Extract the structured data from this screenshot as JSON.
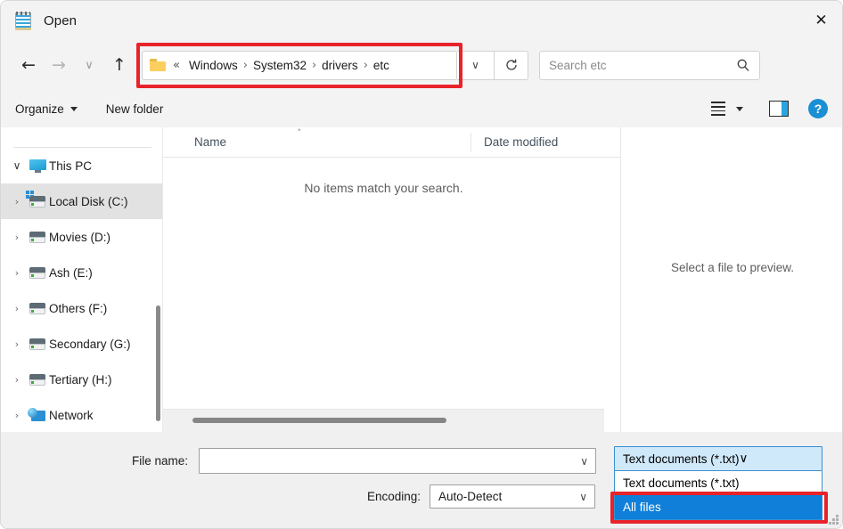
{
  "window": {
    "title": "Open",
    "app_icon": "notepad-icon",
    "close_label": "✕"
  },
  "nav": {
    "back": "←",
    "forward": "→",
    "recent": "∨",
    "up": "↑",
    "dropdown": "∨",
    "refresh_icon": "refresh-icon"
  },
  "breadcrumb": {
    "folder_icon": "folder-icon",
    "overflow": "«",
    "separator": "›",
    "items": [
      "Windows",
      "System32",
      "drivers",
      "etc"
    ]
  },
  "search": {
    "placeholder": "Search etc",
    "icon": "search-icon"
  },
  "commandbar": {
    "organize": "Organize",
    "new_folder": "New folder",
    "view_icon": "list-view-icon",
    "view_caret": "▾",
    "preview_pane_icon": "preview-pane-icon",
    "help": "?"
  },
  "sidebar": {
    "items": [
      {
        "label": "This PC",
        "icon": "computer-icon",
        "chevron": "∨",
        "expanded": true,
        "selected": false
      },
      {
        "label": "Local Disk (C:)",
        "icon": "windows-drive-icon",
        "chevron": "›",
        "expanded": false,
        "selected": true
      },
      {
        "label": "Movies (D:)",
        "icon": "drive-icon",
        "chevron": "›",
        "expanded": false,
        "selected": false
      },
      {
        "label": "Ash (E:)",
        "icon": "drive-icon",
        "chevron": "›",
        "expanded": false,
        "selected": false
      },
      {
        "label": "Others (F:)",
        "icon": "drive-icon",
        "chevron": "›",
        "expanded": false,
        "selected": false
      },
      {
        "label": "Secondary (G:)",
        "icon": "drive-icon",
        "chevron": "›",
        "expanded": false,
        "selected": false
      },
      {
        "label": "Tertiary (H:)",
        "icon": "drive-icon",
        "chevron": "›",
        "expanded": false,
        "selected": false
      },
      {
        "label": "Network",
        "icon": "network-icon",
        "chevron": "›",
        "expanded": false,
        "selected": false
      }
    ]
  },
  "filelist": {
    "columns": [
      "Name",
      "Date modified"
    ],
    "sort_caret": "˄",
    "empty_message": "No items match your search."
  },
  "preview": {
    "message": "Select a file to preview."
  },
  "footer": {
    "file_name_label": "File name:",
    "file_name_value": "",
    "encoding_label": "Encoding:",
    "encoding_value": "Auto-Detect",
    "caret": "∨"
  },
  "filetype": {
    "selected": "Text documents (*.txt)",
    "caret": "∨",
    "options": [
      {
        "label": "Text documents (*.txt)",
        "highlighted": false
      },
      {
        "label": "All files",
        "highlighted": true
      }
    ]
  },
  "annotations": {
    "color": "#e8232a",
    "targets": [
      "breadcrumb",
      "all-files-option"
    ]
  }
}
